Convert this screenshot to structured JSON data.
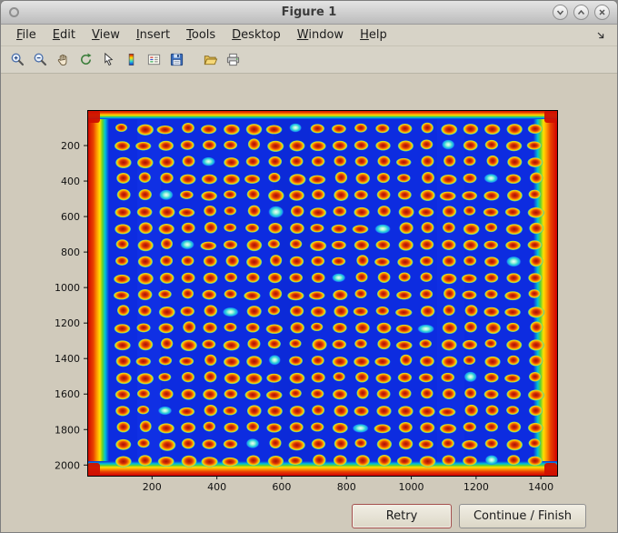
{
  "window": {
    "title": "Figure 1",
    "controls": [
      "minimize",
      "maximize",
      "close"
    ]
  },
  "menubar": {
    "items": [
      "File",
      "Edit",
      "View",
      "Insert",
      "Tools",
      "Desktop",
      "Window",
      "Help"
    ],
    "dock_icon": "dock-arrow"
  },
  "toolbar": {
    "icons": [
      "zoom-in",
      "zoom-out",
      "pan",
      "rotate-3d",
      "data-cursor",
      "colorbar",
      "legend",
      "save",
      "open",
      "print"
    ]
  },
  "actions": {
    "retry": "Retry",
    "continue_finish": "Continue / Finish"
  },
  "figure": {
    "x_ticks": [
      200,
      400,
      600,
      800,
      1000,
      1200,
      1400
    ],
    "y_ticks": [
      200,
      400,
      600,
      800,
      1000,
      1200,
      1400,
      1600,
      1800,
      2000
    ],
    "x_max": 1450,
    "y_max": 2060,
    "well_grid": {
      "rows": 21,
      "cols": 20,
      "x0": 39,
      "dx": 23.9,
      "y0": 21,
      "dy": 18.25,
      "rx": 8,
      "ry": 5.8
    },
    "cool_wells": [
      [
        0,
        8
      ],
      [
        1,
        15
      ],
      [
        2,
        4
      ],
      [
        3,
        17
      ],
      [
        4,
        2
      ],
      [
        5,
        7
      ],
      [
        6,
        12
      ],
      [
        7,
        3
      ],
      [
        8,
        18
      ],
      [
        9,
        10
      ],
      [
        11,
        5
      ],
      [
        12,
        14
      ],
      [
        14,
        7
      ],
      [
        15,
        16
      ],
      [
        17,
        2
      ],
      [
        18,
        11
      ],
      [
        19,
        6
      ],
      [
        20,
        17
      ]
    ],
    "colors": {
      "background_blue": "#0d2ce0",
      "hot_center": "#a81200",
      "hot_ring": "#ff9d00",
      "cool_center": "#f0fff8",
      "edge_red": "#cf0000"
    }
  },
  "chart_data": {
    "type": "heatmap",
    "title": "",
    "xlabel": "",
    "ylabel": "",
    "x_ticks": [
      200,
      400,
      600,
      800,
      1000,
      1200,
      1400
    ],
    "y_ticks": [
      200,
      400,
      600,
      800,
      1000,
      1200,
      1400,
      1600,
      1800,
      2000
    ],
    "x_range": [
      0,
      1450
    ],
    "y_range": [
      0,
      2060
    ],
    "y_axis_direction": "reversed",
    "legend": "off",
    "grid": "off",
    "description": "Pseudo-color (jet colormap) image of a plate/array: uniform blue field with a 21-row by 20-column grid of hot red-orange circular spots, a few cyan/cool spots scattered, and red-to-yellow hot bands along all four image edges."
  }
}
